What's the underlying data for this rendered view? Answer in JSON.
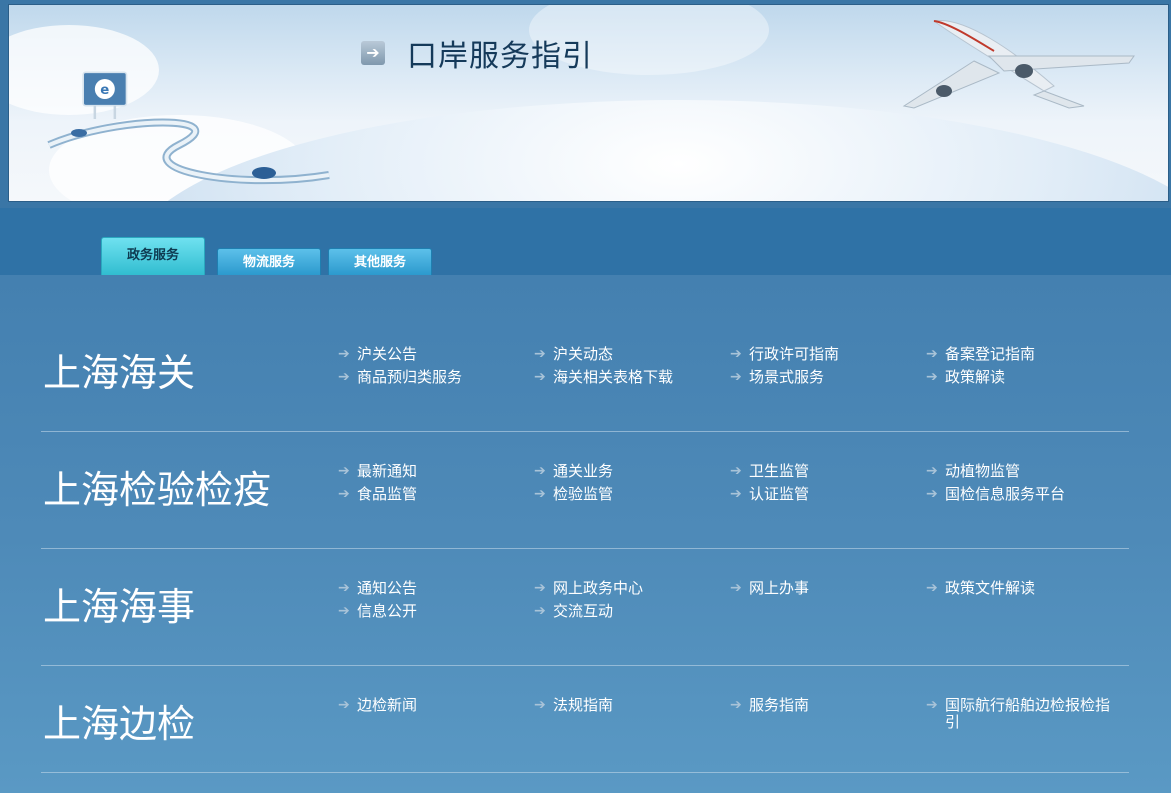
{
  "banner": {
    "title": "口岸服务指引"
  },
  "tabs": [
    {
      "label": "政务服务",
      "active": true
    },
    {
      "label": "物流服务",
      "active": false
    },
    {
      "label": "其他服务",
      "active": false
    }
  ],
  "sections": [
    {
      "title": "上海海关",
      "links": [
        "沪关公告",
        "沪关动态",
        "行政许可指南",
        "备案登记指南",
        "商品预归类服务",
        "海关相关表格下载",
        "场景式服务",
        "政策解读"
      ]
    },
    {
      "title": "上海检验检疫",
      "links": [
        "最新通知",
        "通关业务",
        "卫生监管",
        "动植物监管",
        "食品监管",
        "检验监管",
        "认证监管",
        "国检信息服务平台"
      ]
    },
    {
      "title": "上海海事",
      "links": [
        "通知公告",
        "网上政务中心",
        "网上办事",
        "政策文件解读",
        "信息公开",
        "交流互动"
      ]
    },
    {
      "title": "上海边检",
      "links": [
        "边检新闻",
        "法规指南",
        "服务指南",
        "国际航行船舶边检报检指引"
      ]
    }
  ]
}
